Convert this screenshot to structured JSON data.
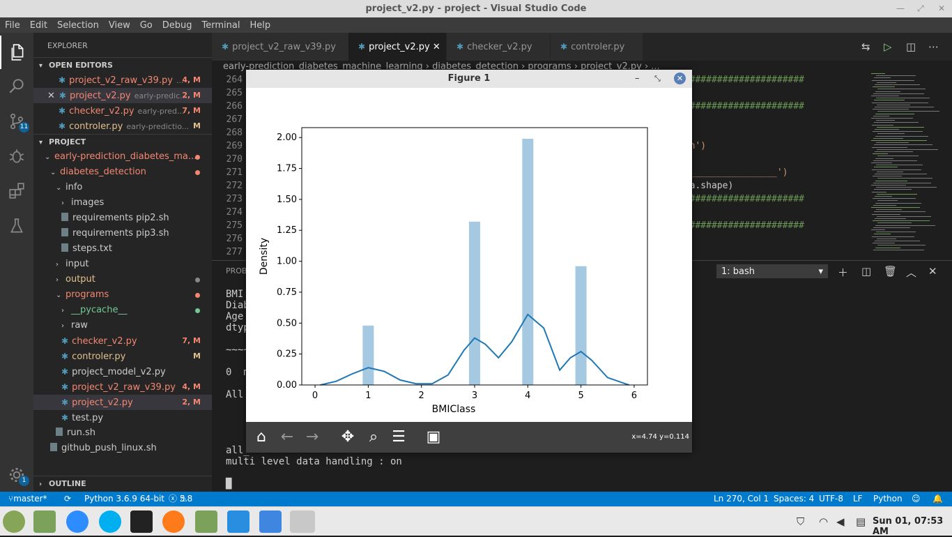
{
  "window_title": "project_v2.py - project - Visual Studio Code",
  "menu": [
    "File",
    "Edit",
    "Selection",
    "View",
    "Go",
    "Debug",
    "Terminal",
    "Help"
  ],
  "activity": {
    "scm_badge": "11",
    "settings_badge": "1"
  },
  "sidebar": {
    "title": "EXPLORER",
    "open_editors_title": "OPEN EDITORS",
    "open_editors": [
      {
        "name": "project_v2_raw_v39.py",
        "desc": "...",
        "status": "4, M"
      },
      {
        "name": "project_v2.py",
        "desc": "early-predic...",
        "status": "2, M"
      },
      {
        "name": "checker_v2.py",
        "desc": "early-pred...",
        "status": "7, M"
      },
      {
        "name": "controler.py",
        "desc": "early-predictio...",
        "status": "M"
      }
    ],
    "project_title": "PROJECT",
    "tree": [
      {
        "name": "early-prediction_diabetes_ma...",
        "indent": 1,
        "chev": "down"
      },
      {
        "name": "diabetes_detection",
        "indent": 2,
        "chev": "down"
      },
      {
        "name": "info",
        "indent": 3,
        "chev": "down"
      },
      {
        "name": "images",
        "indent": 4,
        "chev": "right"
      },
      {
        "name": "requirements pip2.sh",
        "indent": 4
      },
      {
        "name": "requirements pip3.sh",
        "indent": 4
      },
      {
        "name": "steps.txt",
        "indent": 4
      },
      {
        "name": "input",
        "indent": 3,
        "chev": "right"
      },
      {
        "name": "output",
        "indent": 3,
        "chev": "right"
      },
      {
        "name": "programs",
        "indent": 3,
        "chev": "down"
      },
      {
        "name": "__pycache__",
        "indent": 4,
        "chev": "right"
      },
      {
        "name": "raw",
        "indent": 4,
        "chev": "right"
      },
      {
        "name": "checker_v2.py",
        "indent": 4,
        "status": "7, M"
      },
      {
        "name": "controler.py",
        "indent": 4,
        "status": "M"
      },
      {
        "name": "project_model_v2.py",
        "indent": 4
      },
      {
        "name": "project_v2_raw_v39.py",
        "indent": 4,
        "status": "4, M"
      },
      {
        "name": "project_v2.py",
        "indent": 4,
        "status": "2, M"
      },
      {
        "name": "test.py",
        "indent": 4
      },
      {
        "name": "run.sh",
        "indent": 3
      },
      {
        "name": "github_push_linux.sh",
        "indent": 2
      }
    ],
    "outline_title": "OUTLINE"
  },
  "tabs": [
    "project_v2_raw_v39.py",
    "project_v2.py",
    "checker_v2.py",
    "controler.py"
  ],
  "breadcrumb": "early-prediction_diabetes_machine_learning › diabetes_detection › programs › project_v2.py › ...",
  "editor": {
    "line_numbers": [
      "264",
      "265",
      "266",
      "267",
      "268",
      "269",
      "270",
      "271",
      "272",
      "273",
      "274",
      "275",
      "276",
      "277"
    ],
    "visible_code": [
      {
        "line": 0,
        "text": "#######################",
        "cls": "hash"
      },
      {
        "line": 2,
        "text": "#######################",
        "cls": "hash"
      },
      {
        "line": 5,
        "text": "/\\n')",
        "cls": "str"
      },
      {
        "line": 7,
        "text": "__________________')",
        "cls": "str"
      },
      {
        "line": 8,
        "text": "ata.shape)",
        "cls": ""
      },
      {
        "line": 9,
        "text": "#######################",
        "cls": "hash"
      },
      {
        "line": 11,
        "text": "#######################",
        "cls": "hash"
      }
    ]
  },
  "panel": {
    "tab_partial": "PROB",
    "terminal_select": "1: bash",
    "lines_left": [
      "BMI",
      "Diab",
      "Age",
      "dtyp",
      "",
      "~~~~",
      "",
      "0  m",
      "",
      "All",
      "",
      "",
      ""
    ],
    "bottom_lines": [
      "all_",
      "multi level data handling : on",
      "",
      "█"
    ]
  },
  "statusbar": {
    "branch": "master*",
    "python": "Python 3.6.9 64-bit",
    "errors": "5",
    "warnings": "8",
    "position": "Ln 270, Col 1",
    "spaces": "Spaces: 4",
    "encoding": "UTF-8",
    "eol": "LF",
    "language": "Python"
  },
  "taskbar": {
    "clock": "Sun 01, 07:53 AM"
  },
  "figure": {
    "title": "Figure 1",
    "coords": "x=4.74 y=0.114"
  },
  "colors": {
    "accent": "#007acc",
    "bars": "#a6c9e2",
    "kde": "#1f77b4"
  },
  "chart_data": {
    "type": "bar",
    "xlabel": "BMIClass",
    "ylabel": "Density",
    "xlim": [
      -0.25,
      6.25
    ],
    "ylim": [
      0,
      2.08
    ],
    "xticks": [
      "0",
      "1",
      "2",
      "3",
      "4",
      "5",
      "6"
    ],
    "yticks": [
      "0.00",
      "0.25",
      "0.50",
      "0.75",
      "1.00",
      "1.25",
      "1.50",
      "1.75",
      "2.00"
    ],
    "bars": [
      {
        "x": 1,
        "value": 0.48
      },
      {
        "x": 3,
        "value": 1.32
      },
      {
        "x": 4,
        "value": 1.99
      },
      {
        "x": 5,
        "value": 0.96
      }
    ],
    "kde": {
      "x": [
        0.1,
        0.4,
        0.7,
        1.0,
        1.3,
        1.6,
        1.9,
        2.2,
        2.5,
        2.8,
        3.0,
        3.2,
        3.45,
        3.7,
        4.0,
        4.3,
        4.6,
        4.8,
        5.0,
        5.2,
        5.5,
        5.9
      ],
      "y": [
        0.0,
        0.03,
        0.09,
        0.14,
        0.11,
        0.04,
        0.01,
        0.01,
        0.08,
        0.28,
        0.38,
        0.33,
        0.22,
        0.35,
        0.57,
        0.46,
        0.12,
        0.22,
        0.27,
        0.2,
        0.06,
        0.0
      ]
    }
  }
}
